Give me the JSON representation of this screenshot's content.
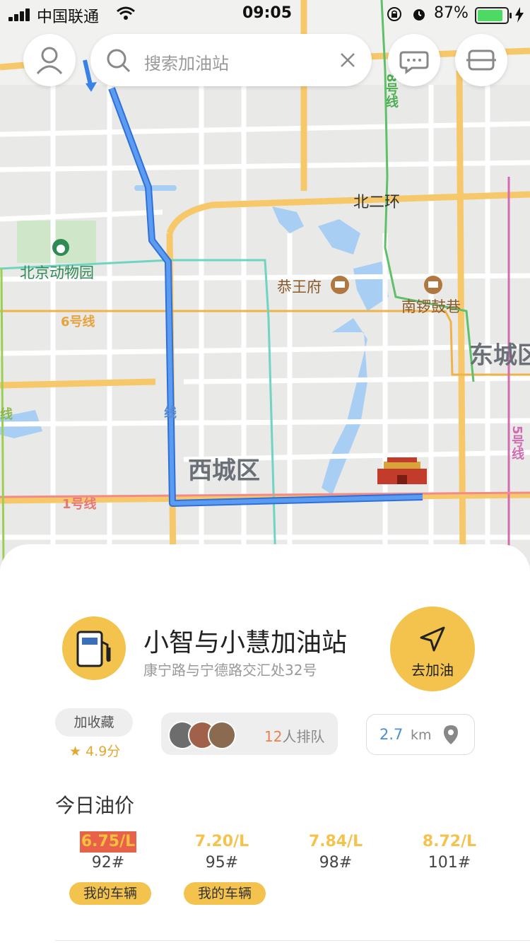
{
  "status_bar": {
    "carrier": "中国联通",
    "time": "09:05",
    "battery_percent": "87%",
    "battery_level": 0.87
  },
  "search": {
    "placeholder": "搜索加油站"
  },
  "map": {
    "labels": {
      "ring_road": "北二环",
      "zoo": "北京动物园",
      "gongwangfu": "恭王府",
      "nanluoguxiang": "南锣鼓巷",
      "dongcheng": "东城区",
      "xicheng": "西城区",
      "line6": "6号线",
      "line1": "1号线",
      "line8": "8号线",
      "line5": "5号线",
      "line4": "线",
      "line9": "线"
    }
  },
  "station": {
    "name": "小智与小慧加油站",
    "address": "康宁路与宁德路交汇处32号",
    "go_label": "去加油",
    "favorite_label": "加收藏",
    "rating": "4.9分",
    "queue_count": "12",
    "queue_text": "人排队",
    "distance_value": "2.7",
    "distance_unit": "km"
  },
  "prices": {
    "title": "今日油价",
    "items": [
      {
        "price": "6.75/L",
        "grade": "92#",
        "badge": "我的车辆"
      },
      {
        "price": "7.20/L",
        "grade": "95#",
        "badge": "我的车辆"
      },
      {
        "price": "7.84/L",
        "grade": "98#",
        "badge": ""
      },
      {
        "price": "8.72/L",
        "grade": "101#",
        "badge": ""
      }
    ]
  },
  "colors": {
    "accent": "#f3c34d",
    "route": "#3b82e8",
    "highlight": "#e8624a"
  }
}
